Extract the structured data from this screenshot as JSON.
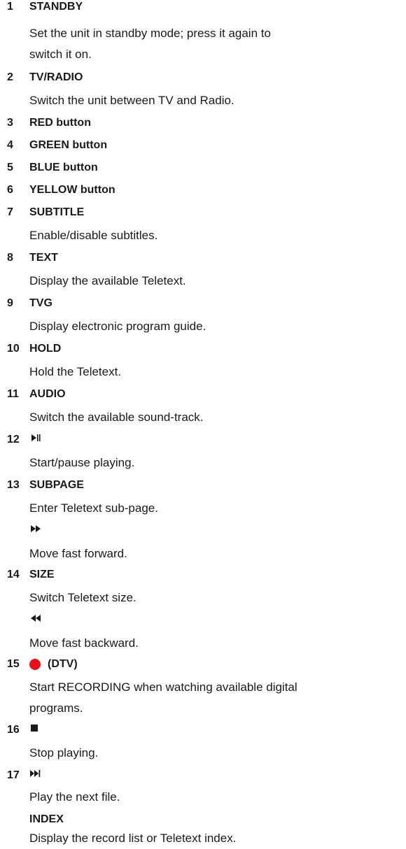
{
  "entries": [
    {
      "num": "1",
      "title": "STANDBY",
      "desc1": "Set the unit in standby mode; press it again to",
      "desc2": "switch it on."
    },
    {
      "num": "2",
      "title": "TV/RADIO",
      "desc1": "Switch the unit between TV and Radio."
    },
    {
      "num": "3",
      "title": "RED button"
    },
    {
      "num": "4",
      "title": "GREEN button"
    },
    {
      "num": "5",
      "title": "BLUE button"
    },
    {
      "num": "6",
      "title": "YELLOW button"
    },
    {
      "num": "7",
      "title": "SUBTITLE",
      "desc1": "Enable/disable subtitles."
    },
    {
      "num": "8",
      "title": "TEXT",
      "desc1": "Display the available Teletext."
    },
    {
      "num": "9",
      "title": "TVG",
      "desc1": "Display electronic program guide."
    },
    {
      "num": "10",
      "title": "HOLD",
      "desc1": "Hold the Teletext."
    },
    {
      "num": "11",
      "title": "AUDIO",
      "desc1": "Switch the available sound-track."
    },
    {
      "num": "12",
      "icon": "play-pause-icon",
      "desc1": "Start/pause playing."
    },
    {
      "num": "13",
      "title": "SUBPAGE",
      "desc1": "Enter Teletext sub-page.",
      "icon2": "fast-forward-icon",
      "desc2": "Move fast forward."
    },
    {
      "num": "14",
      "title": "SIZE",
      "desc1": "Switch Teletext size.",
      "icon2": "fast-backward-icon",
      "desc2": "Move fast backward."
    },
    {
      "num": "15",
      "icon": "record-icon",
      "title": "(DTV)",
      "desc1": "Start RECORDING when watching available digital",
      "desc2": "programs."
    },
    {
      "num": "16",
      "icon": "stop-icon",
      "desc1": "Stop playing."
    },
    {
      "num": "17",
      "icon": "next-icon",
      "desc1": "Play the next file.",
      "title2": "INDEX",
      "desc2": "Display the record list or Teletext index."
    }
  ],
  "colors": {
    "text": "#1a1a1a",
    "record": "#e8101a"
  }
}
